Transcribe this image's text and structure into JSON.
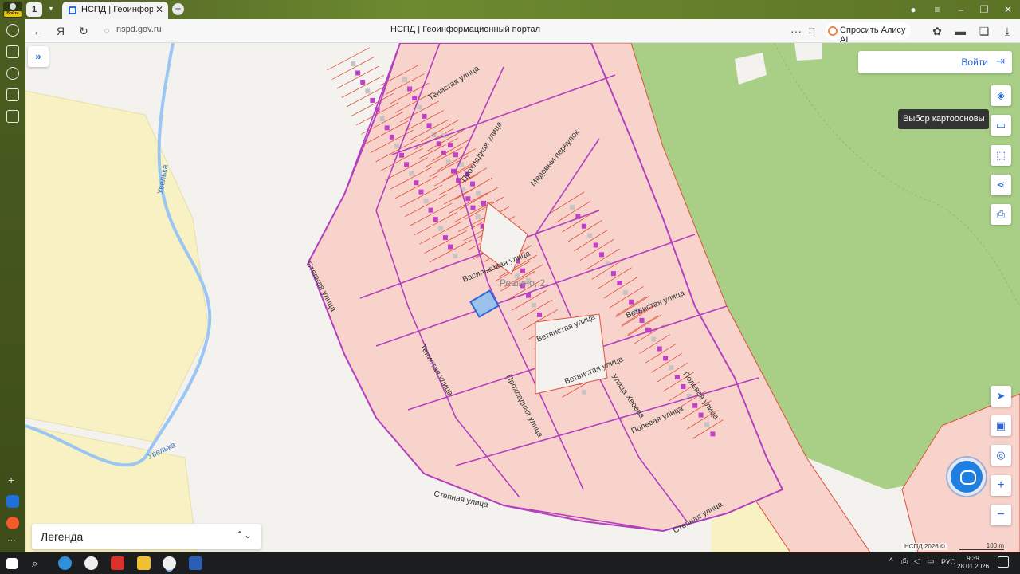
{
  "browser": {
    "profile_badge": "Войти",
    "tab_count": "1",
    "tab_title": "НСПД | Геоинформационный портал",
    "url": "nspd.gov.ru",
    "page_title": "НСПД | Геоинформационный портал",
    "alice_label": "Спросить Алису AI"
  },
  "map": {
    "login_label": "Войти",
    "basemap_tooltip": "Выбор картоосновы",
    "legend_label": "Легенда",
    "copyright": "НСПД 2026 ©",
    "scale_label": "100 m",
    "settlement_label": "Решино, 2",
    "river_label": "Увелька",
    "streets": {
      "stepnaya": "Степная улица",
      "tenistaya": "Тенистая улица",
      "prokhladnaya": "Прохладная улица",
      "medovy": "Медовый переулок",
      "vasilkovaya": "Васильковая улица",
      "vetvistaya": "Ветвистая улица",
      "polevaya": "Полевая улица",
      "khvoynaya": "Улица Хвоева"
    },
    "colors": {
      "forest": "#a8cf85",
      "farmland": "#f8f1c4",
      "parcel_fill": "#f7d3cc",
      "parcel_line": "#e0503c",
      "boundary": "#b43fbf",
      "river": "#9cc6f2",
      "selected": "#2a6ad8"
    }
  },
  "taskbar": {
    "language": "РУС",
    "time": "9:39",
    "date": "28.01.2026"
  }
}
